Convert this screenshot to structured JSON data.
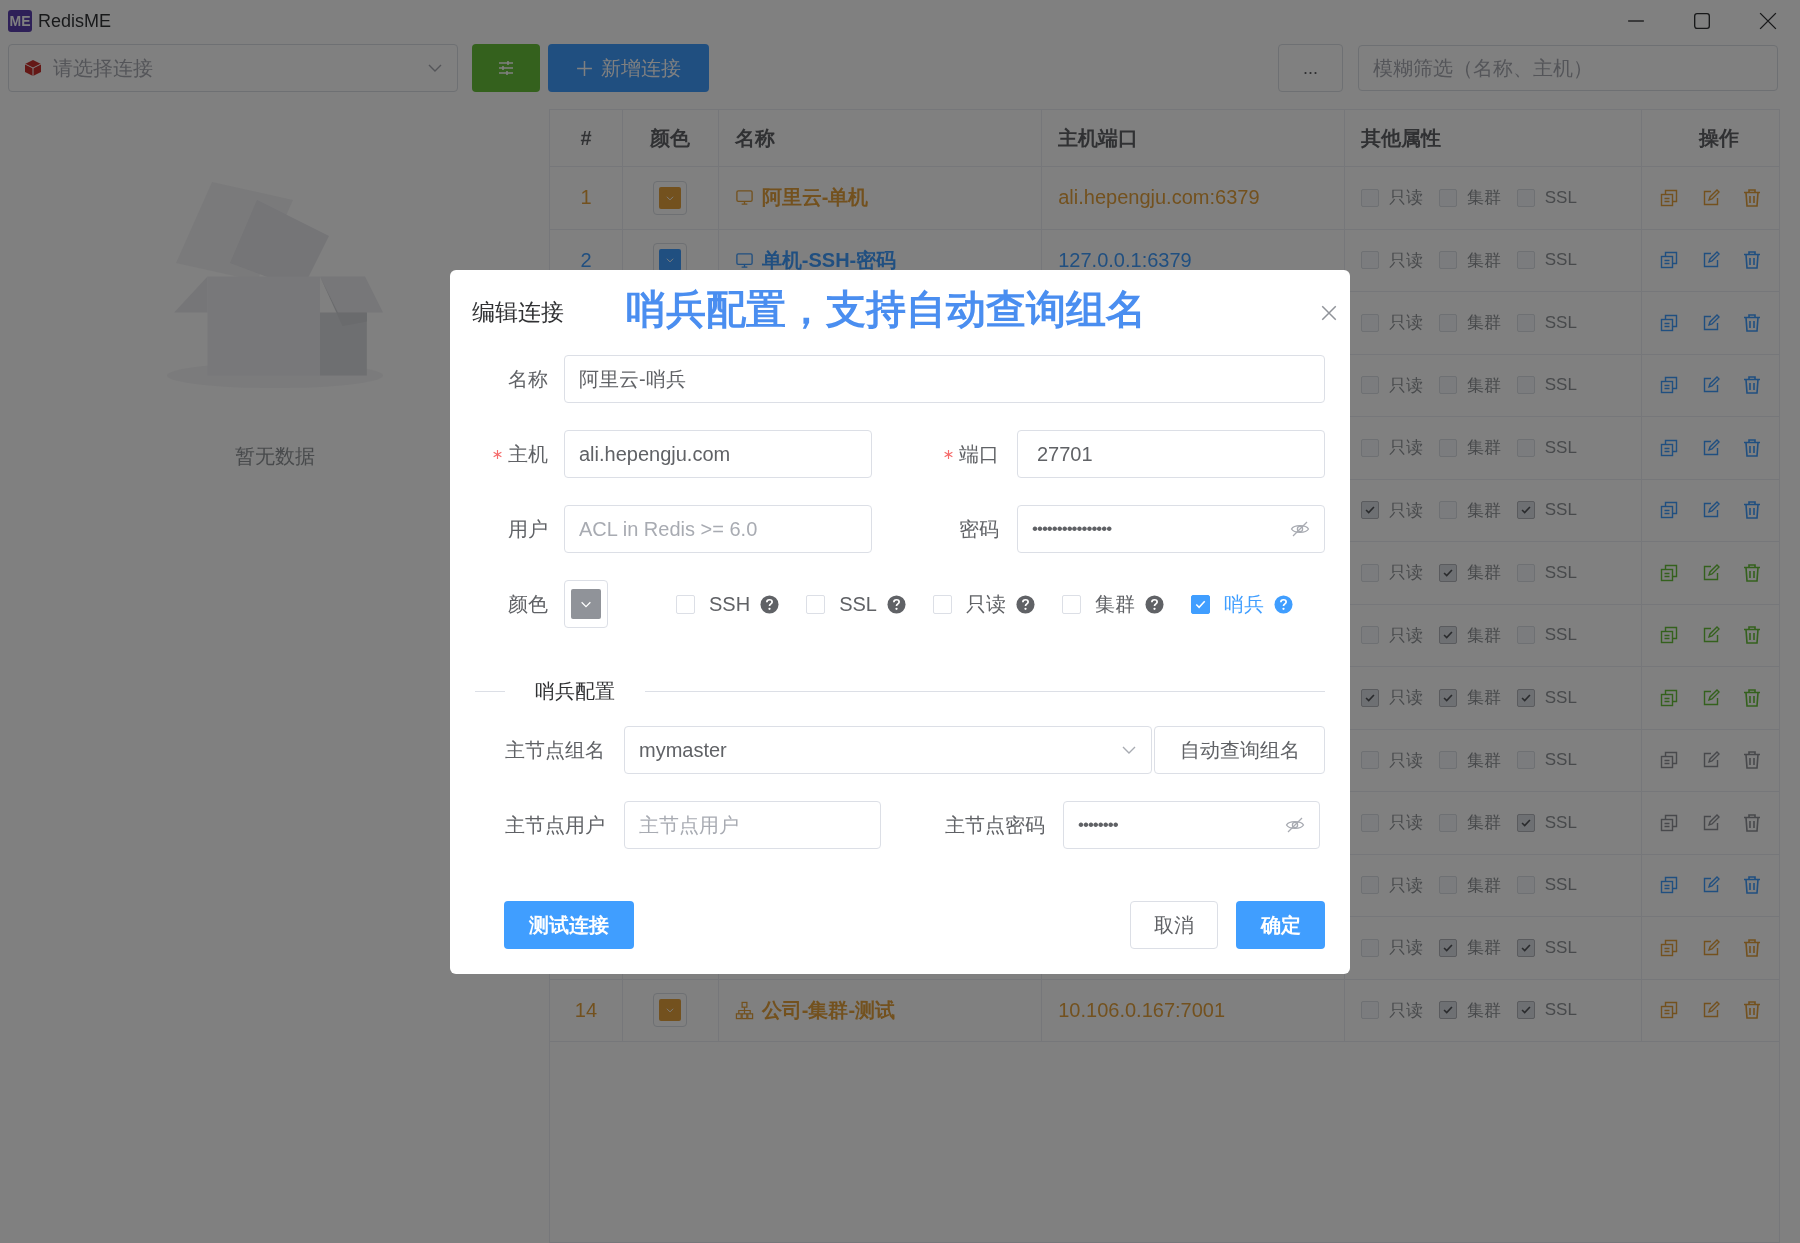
{
  "window": {
    "logo": "ME",
    "title": "RedisME"
  },
  "toolbar": {
    "connection_select": {
      "placeholder": "请选择连接"
    },
    "new_button": "新增连接",
    "more_button": "...",
    "search": {
      "placeholder": "模糊筛选（名称、主机）"
    }
  },
  "empty_state": {
    "text": "暂无数据"
  },
  "table": {
    "columns": [
      "#",
      "颜色",
      "名称",
      "主机端口",
      "其他属性",
      "操作"
    ],
    "rows": [
      {
        "index": "1",
        "color": "#73511e",
        "kind": "single",
        "name": "阿里云-单机",
        "host": "ali.hepengju.com:6379",
        "flags": [
          {
            "label": "只读",
            "checked": false
          },
          {
            "label": "集群",
            "checked": false
          },
          {
            "label": "SSL",
            "checked": false
          }
        ]
      },
      {
        "index": "2",
        "color": "#204f80",
        "kind": "single",
        "name": "单机-SSH-密码",
        "host": "127.0.0.1:6379",
        "flags": [
          {
            "label": "只读",
            "checked": false
          },
          {
            "label": "集群",
            "checked": false
          },
          {
            "label": "SSL",
            "checked": false
          }
        ]
      },
      {
        "color": "#204f80",
        "flags": [
          {
            "label": "只读",
            "checked": false
          },
          {
            "label": "集群",
            "checked": false
          },
          {
            "label": "SSL",
            "checked": false
          }
        ]
      },
      {
        "color": "#204f80",
        "flags": [
          {
            "label": "只读",
            "checked": false
          },
          {
            "label": "集群",
            "checked": false
          },
          {
            "label": "SSL",
            "checked": false
          }
        ]
      },
      {
        "color": "#204f80",
        "flags": [
          {
            "label": "只读",
            "checked": false
          },
          {
            "label": "集群",
            "checked": false
          },
          {
            "label": "SSL",
            "checked": false
          }
        ]
      },
      {
        "color": "#204f80",
        "flags": [
          {
            "label": "只读",
            "checked": true
          },
          {
            "label": "集群",
            "checked": false
          },
          {
            "label": "SSL",
            "checked": true
          }
        ]
      },
      {
        "color": "#34611d",
        "flags": [
          {
            "label": "只读",
            "checked": false
          },
          {
            "label": "集群",
            "checked": true
          },
          {
            "label": "SSL",
            "checked": false
          }
        ]
      },
      {
        "color": "#34611d",
        "flags": [
          {
            "label": "只读",
            "checked": false
          },
          {
            "label": "集群",
            "checked": true
          },
          {
            "label": "SSL",
            "checked": false
          }
        ]
      },
      {
        "color": "#34611d",
        "flags": [
          {
            "label": "只读",
            "checked": true
          },
          {
            "label": "集群",
            "checked": true
          },
          {
            "label": "SSL",
            "checked": true
          }
        ]
      },
      {
        "color": "#48494c",
        "flags": [
          {
            "label": "只读",
            "checked": false
          },
          {
            "label": "集群",
            "checked": false
          },
          {
            "label": "SSL",
            "checked": false
          }
        ]
      },
      {
        "color": "#48494c",
        "flags": [
          {
            "label": "只读",
            "checked": false
          },
          {
            "label": "集群",
            "checked": false
          },
          {
            "label": "SSL",
            "checked": true
          }
        ]
      },
      {
        "color": "#204f80",
        "flags": [
          {
            "label": "只读",
            "checked": false
          },
          {
            "label": "集群",
            "checked": false
          },
          {
            "label": "SSL",
            "checked": false
          }
        ]
      },
      {
        "color": "#73511e",
        "flags": [
          {
            "label": "只读",
            "checked": false
          },
          {
            "label": "集群",
            "checked": true
          },
          {
            "label": "SSL",
            "checked": true
          }
        ]
      },
      {
        "index": "14",
        "color": "#73511e",
        "kind": "cluster",
        "name": "公司-集群-测试",
        "host": "10.106.0.167:7001",
        "flags": [
          {
            "label": "只读",
            "checked": false
          },
          {
            "label": "集群",
            "checked": true
          },
          {
            "label": "SSL",
            "checked": true
          }
        ]
      }
    ]
  },
  "dialog": {
    "title": "编辑连接",
    "annotation": "哨兵配置，支持自动查询组名",
    "name": {
      "label": "名称",
      "value": "阿里云-哨兵"
    },
    "host": {
      "label": "主机",
      "required": true,
      "value": "ali.hepengju.com"
    },
    "port": {
      "label": "端口",
      "required": true,
      "value": "27701"
    },
    "user": {
      "label": "用户",
      "placeholder": "ACL in Redis >= 6.0"
    },
    "password": {
      "label": "密码",
      "value": "••••••••••••••••"
    },
    "color": {
      "label": "颜色",
      "color": "#909399"
    },
    "options": [
      {
        "label": "SSH",
        "checked": false
      },
      {
        "label": "SSL",
        "checked": false
      },
      {
        "label": "只读",
        "checked": false
      },
      {
        "label": "集群",
        "checked": false
      },
      {
        "label": "哨兵",
        "checked": true
      }
    ],
    "section": "哨兵配置",
    "master_name": {
      "label": "主节点组名",
      "value": "mymaster"
    },
    "auto_query_button": "自动查询组名",
    "master_user": {
      "label": "主节点用户",
      "placeholder": "主节点用户"
    },
    "master_password": {
      "label": "主节点密码",
      "value": "••••••••"
    },
    "buttons": {
      "test": "测试连接",
      "cancel": "取消",
      "ok": "确定"
    }
  }
}
